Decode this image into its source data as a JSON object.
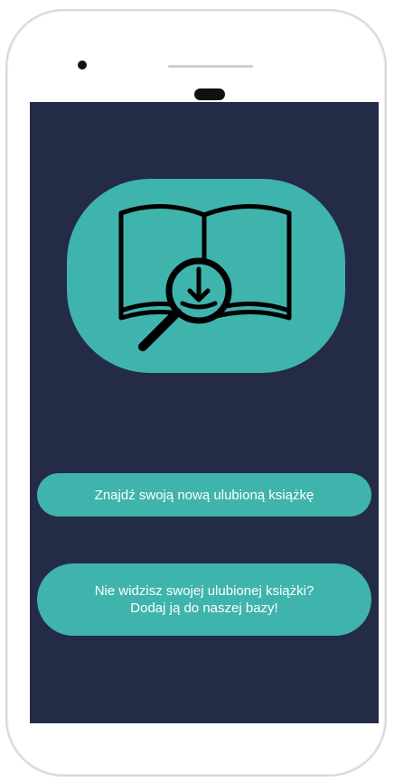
{
  "app": {
    "logo_icon": "book-search-icon",
    "colors": {
      "background": "#242b47",
      "accent": "#3fb4ad",
      "text": "#ffffff"
    }
  },
  "buttons": {
    "find_label": "Znajdź swoją nową ulubioną książkę",
    "add_line1": "Nie widzisz swojej ulubionej książki?",
    "add_line2": "Dodaj ją do naszej bazy!"
  }
}
